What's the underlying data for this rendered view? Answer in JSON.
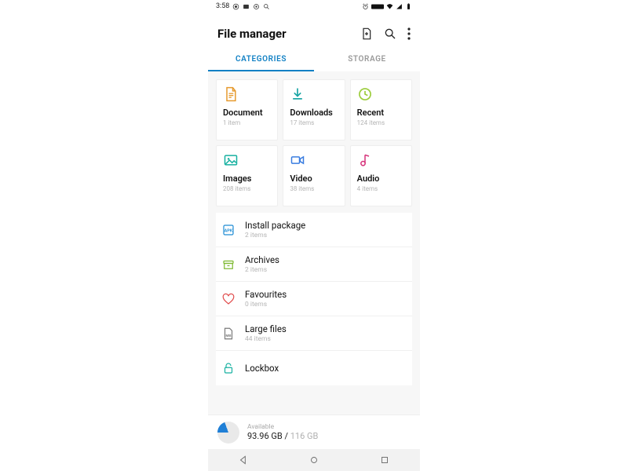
{
  "statusbar": {
    "time": "3:58"
  },
  "header": {
    "title": "File manager"
  },
  "tabs": {
    "categories": "CATEGORIES",
    "storage": "STORAGE"
  },
  "grid": {
    "document": {
      "label": "Document",
      "sub": "1 item"
    },
    "downloads": {
      "label": "Downloads",
      "sub": "17 items"
    },
    "recent": {
      "label": "Recent",
      "sub": "124 items"
    },
    "images": {
      "label": "Images",
      "sub": "208 items"
    },
    "video": {
      "label": "Video",
      "sub": "38 items"
    },
    "audio": {
      "label": "Audio",
      "sub": "4 items"
    }
  },
  "list": {
    "install": {
      "label": "Install package",
      "sub": "2 items"
    },
    "archives": {
      "label": "Archives",
      "sub": "2 items"
    },
    "favourites": {
      "label": "Favourites",
      "sub": "0 items"
    },
    "large": {
      "label": "Large files",
      "sub": "44 items"
    },
    "lockbox": {
      "label": "Lockbox"
    }
  },
  "storage_footer": {
    "available_label": "Available",
    "free": "93.96 GB",
    "sep": " / ",
    "total": "116 GB"
  }
}
